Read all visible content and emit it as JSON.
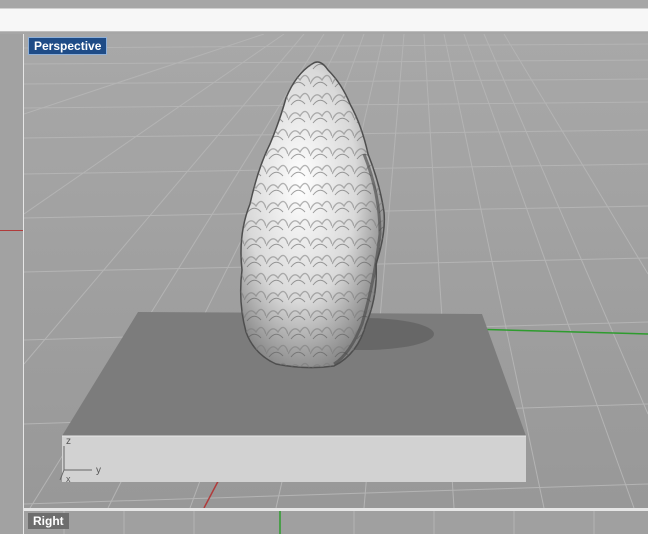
{
  "viewport": {
    "name": "Perspective"
  },
  "bottom_viewport": {
    "name": "Right"
  },
  "axes": {
    "z": "z",
    "y": "y",
    "x": "x"
  }
}
